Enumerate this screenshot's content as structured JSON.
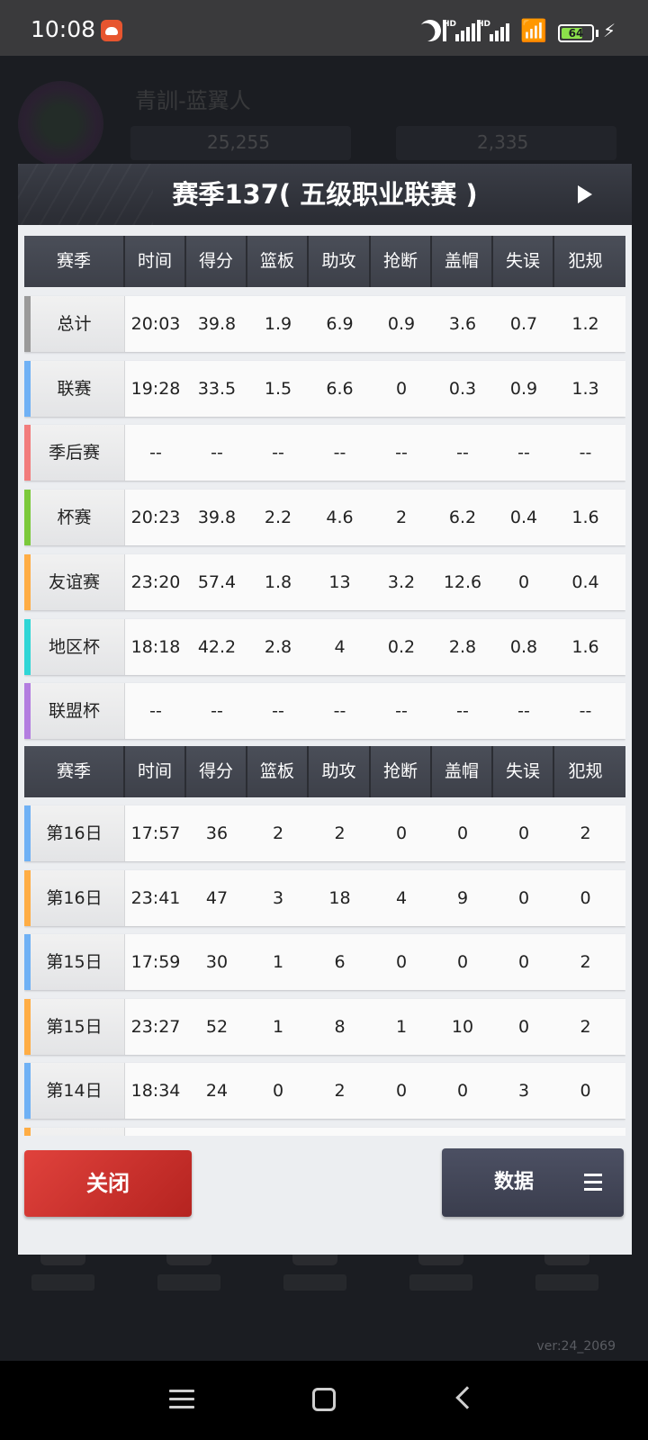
{
  "status_bar": {
    "time": "10:08",
    "battery": "64",
    "signal_label_1": "HD",
    "signal_label_2": "HD",
    "battery_color": "#8ce04a"
  },
  "background": {
    "player_name": "青訓-蓝翼人",
    "coins": "25,255",
    "gems": "2,335",
    "version": "ver:24_2069"
  },
  "modal": {
    "title": "赛季137( 五级职业联赛 )",
    "columns": [
      "赛季",
      "时间",
      "得分",
      "篮板",
      "助攻",
      "抢断",
      "盖帽",
      "失误",
      "犯规"
    ],
    "summary_rows": [
      {
        "label": "总计",
        "stripe": "#9a9a9a",
        "values": [
          "20:03",
          "39.8",
          "1.9",
          "6.9",
          "0.9",
          "3.6",
          "0.7",
          "1.2"
        ]
      },
      {
        "label": "联赛",
        "stripe": "#6fb1f5",
        "values": [
          "19:28",
          "33.5",
          "1.5",
          "6.6",
          "0",
          "0.3",
          "0.9",
          "1.3"
        ]
      },
      {
        "label": "季后赛",
        "stripe": "#f27c7c",
        "values": [
          "--",
          "--",
          "--",
          "--",
          "--",
          "--",
          "--",
          "--"
        ]
      },
      {
        "label": "杯赛",
        "stripe": "#7bc93b",
        "values": [
          "20:23",
          "39.8",
          "2.2",
          "4.6",
          "2",
          "6.2",
          "0.4",
          "1.6"
        ]
      },
      {
        "label": "友谊赛",
        "stripe": "#ffad45",
        "values": [
          "23:20",
          "57.4",
          "1.8",
          "13",
          "3.2",
          "12.6",
          "0",
          "0.4"
        ]
      },
      {
        "label": "地区杯",
        "stripe": "#2fd6d6",
        "values": [
          "18:18",
          "42.2",
          "2.8",
          "4",
          "0.2",
          "2.8",
          "0.8",
          "1.6"
        ]
      },
      {
        "label": "联盟杯",
        "stripe": "#b37de0",
        "values": [
          "--",
          "--",
          "--",
          "--",
          "--",
          "--",
          "--",
          "--"
        ]
      }
    ],
    "game_rows": [
      {
        "label": "第16日",
        "stripe": "#6fb1f5",
        "values": [
          "17:57",
          "36",
          "2",
          "2",
          "0",
          "0",
          "0",
          "2"
        ]
      },
      {
        "label": "第16日",
        "stripe": "#ffad45",
        "values": [
          "23:41",
          "47",
          "3",
          "18",
          "4",
          "9",
          "0",
          "0"
        ]
      },
      {
        "label": "第15日",
        "stripe": "#6fb1f5",
        "values": [
          "17:59",
          "30",
          "1",
          "6",
          "0",
          "0",
          "0",
          "2"
        ]
      },
      {
        "label": "第15日",
        "stripe": "#ffad45",
        "values": [
          "23:27",
          "52",
          "1",
          "8",
          "1",
          "10",
          "0",
          "2"
        ]
      },
      {
        "label": "第14日",
        "stripe": "#6fb1f5",
        "values": [
          "18:34",
          "24",
          "0",
          "2",
          "0",
          "0",
          "3",
          "0"
        ]
      },
      {
        "label": "",
        "stripe": "#ffad45",
        "values": [
          "",
          "",
          "",
          "",
          "",
          "",
          "",
          ""
        ]
      }
    ],
    "close_label": "关闭",
    "data_label": "数据"
  }
}
